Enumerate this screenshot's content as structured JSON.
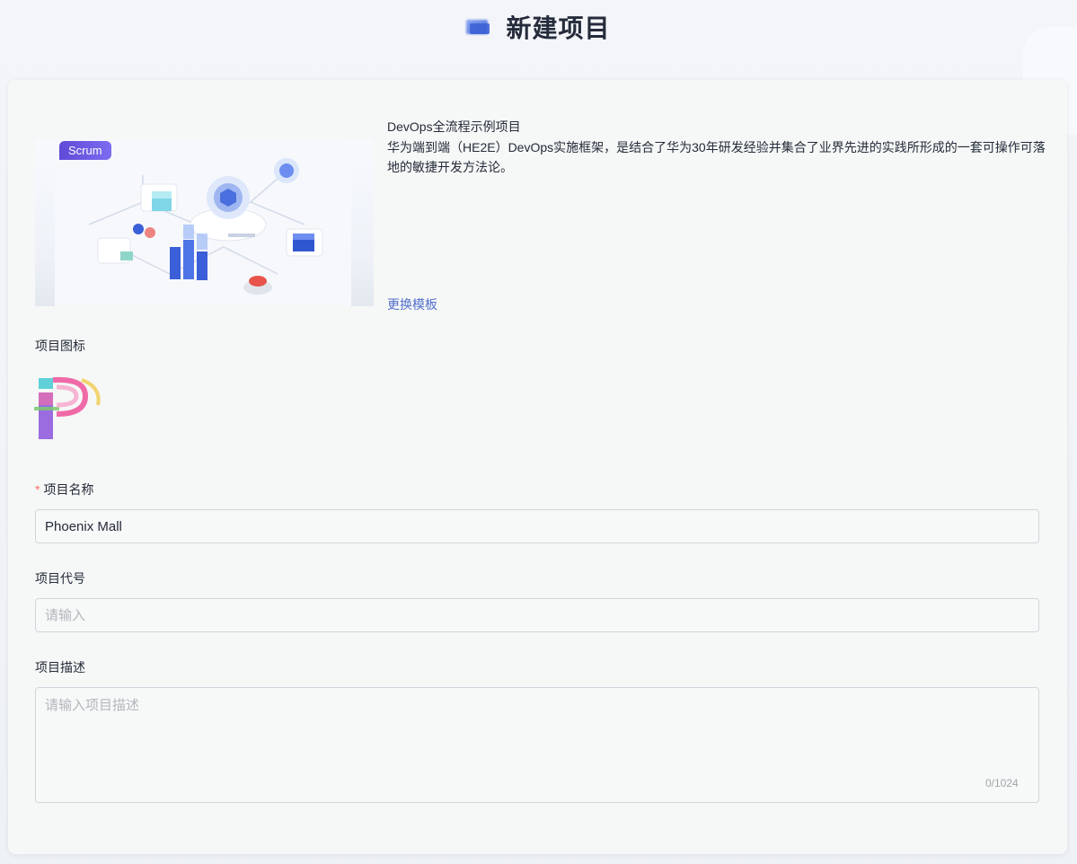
{
  "header": {
    "title": "新建项目",
    "icon": "project-header-icon"
  },
  "template": {
    "badge": "Scrum",
    "name": "DevOps全流程示例项目",
    "description": "华为端到端（HE2E）DevOps实施框架，是结合了华为30年研发经验并集合了业界先进的实践所形成的一套可操作可落地的敏捷开发方法论。",
    "change_link": "更换模板"
  },
  "form": {
    "icon_label": "项目图标",
    "name_label": "项目名称",
    "name_value": "Phoenix Mall",
    "code_label": "项目代号",
    "code_placeholder": "请输入",
    "desc_label": "项目描述",
    "desc_placeholder": "请输入项目描述",
    "desc_counter": "0/1024"
  },
  "colors": {
    "accent": "#526ecc",
    "required": "#f66f6a",
    "badge": "#6b5ae3"
  }
}
